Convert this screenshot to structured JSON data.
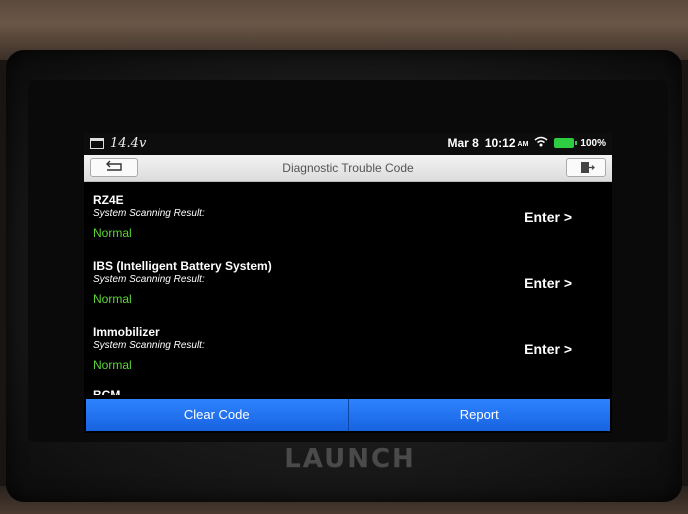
{
  "status_bar": {
    "voltage": "14.4v",
    "date": "Mar 8",
    "time": "10:12",
    "ampm": "AM",
    "battery": "100%"
  },
  "header": {
    "title": "Diagnostic Trouble Code",
    "back_icon": "back-arrow-icon",
    "exit_icon": "exit-icon"
  },
  "systems": [
    {
      "name": "RZ4E",
      "sub": "System Scanning Result:",
      "status": "Normal",
      "action": "Enter >"
    },
    {
      "name": "IBS (Intelligent Battery System)",
      "sub": "System Scanning Result:",
      "status": "Normal",
      "action": "Enter >"
    },
    {
      "name": "Immobilizer",
      "sub": "System Scanning Result:",
      "status": "Normal",
      "action": "Enter >"
    }
  ],
  "partial_item": "BCM",
  "buttons": {
    "clear": "Clear Code",
    "report": "Report"
  },
  "device": {
    "brand": "LAUNCH"
  },
  "colors": {
    "status_normal": "#5cd637",
    "button_blue": "#1f6ff0",
    "battery": "#2ecc40"
  }
}
